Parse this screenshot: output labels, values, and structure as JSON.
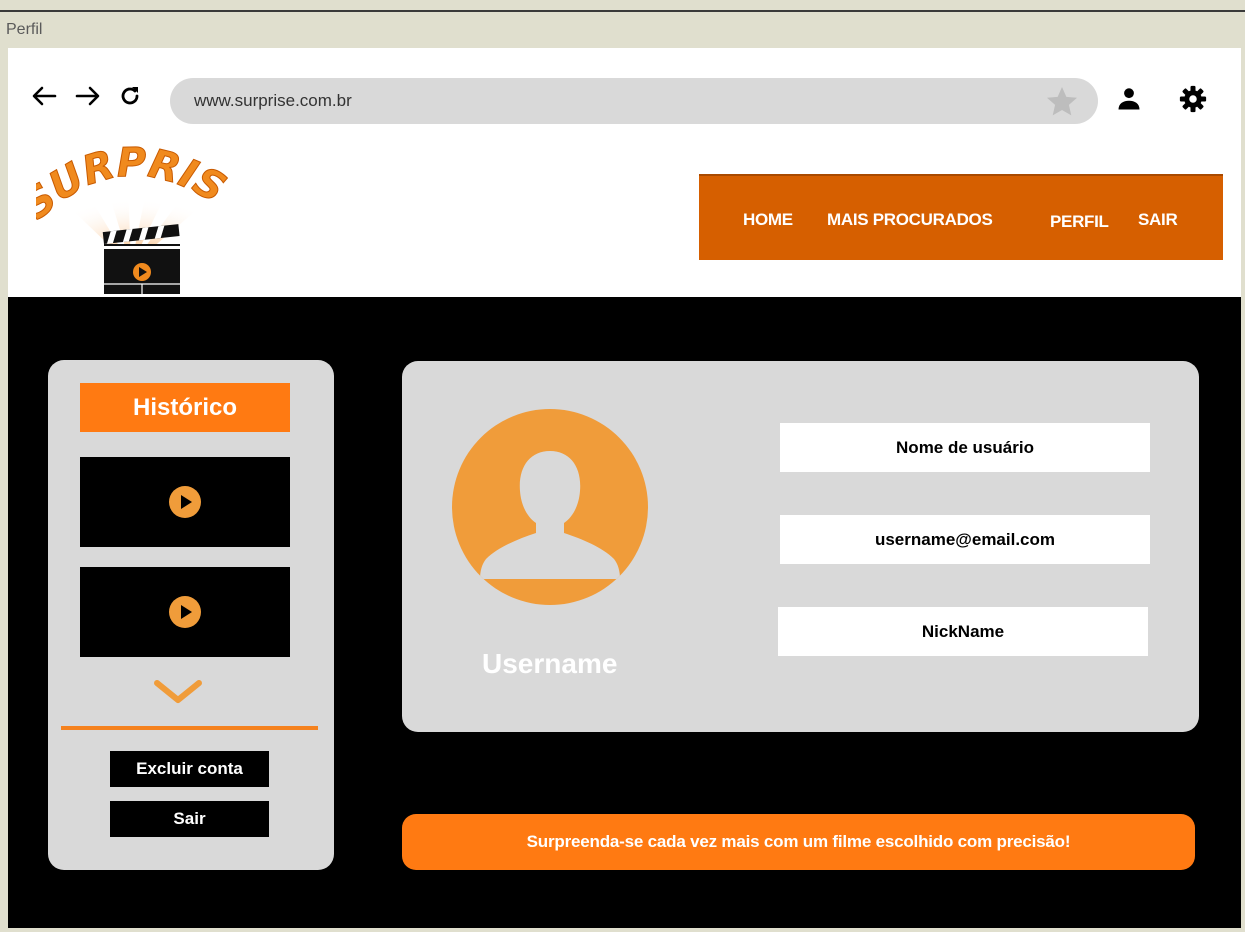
{
  "window": {
    "title": "Perfil"
  },
  "browser": {
    "back_icon": "arrow-left-icon",
    "forward_icon": "arrow-right-icon",
    "reload_icon": "reload-icon",
    "url": "www.surprise.com.br",
    "bookmark_icon": "star-icon",
    "profile_icon": "user-icon",
    "settings_icon": "gear-icon"
  },
  "header": {
    "logo_text": "SURPRISE",
    "nav": [
      {
        "label": "HOME"
      },
      {
        "label": "MAIS PROCURADOS"
      },
      {
        "label": "PERFIL"
      },
      {
        "label": "SAIR"
      }
    ]
  },
  "sidebar": {
    "title": "Histórico",
    "items": [
      {
        "icon": "play-icon"
      },
      {
        "icon": "play-icon"
      }
    ],
    "more_icon": "chevron-down-icon",
    "delete_label": "Excluir conta",
    "logout_label": "Sair"
  },
  "profile": {
    "username_label": "Username",
    "fields": {
      "name": "Nome de usuário",
      "email": "username@email.com",
      "nickname": "NickName"
    }
  },
  "footer": {
    "banner": "Surpreenda-se cada vez mais com um filme escolhido com precisão!"
  },
  "colors": {
    "accent": "#ff7a12",
    "menu": "#d65f00",
    "avatar": "#f09c3a",
    "panel": "#d9d9d9",
    "background": "#000000"
  }
}
